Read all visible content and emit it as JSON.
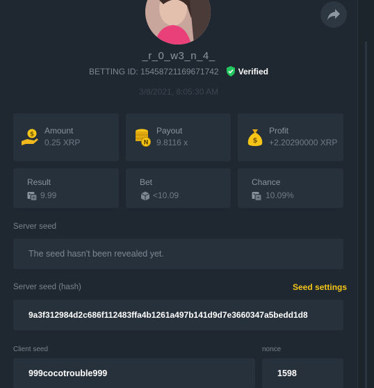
{
  "profile": {
    "username": "_r_0_w3_n_4_",
    "betting_id": "BETTING ID: 15458721169671742",
    "verified_label": "Verified",
    "date": "3/8/2021, 8:05:30 AM"
  },
  "stats": {
    "amount": {
      "label": "Amount",
      "value": "0.25 XRP",
      "icon": "money-bag-icon"
    },
    "payout": {
      "label": "Payout",
      "value": "9.8116 x",
      "icon": "coin-stack-icon"
    },
    "profit": {
      "label": "Profit",
      "value": "+2.20290000 XRP",
      "icon": "money-sack-icon"
    },
    "result": {
      "label": "Result",
      "value": "9.99",
      "icon": "dice-icon"
    },
    "bet": {
      "label": "Bet",
      "value": "<10.09",
      "icon": "cube-icon"
    },
    "chance": {
      "label": "Chance",
      "value": "10.09%",
      "icon": "dice-icon"
    }
  },
  "server_seed": {
    "label": "Server seed",
    "value": "The seed hasn't been revealed yet."
  },
  "server_seed_hash": {
    "label": "Server seed (hash)",
    "value": "9a3f312984d2c686f112483ffa4b1261a497b141d9d7e3660347a5bedd1d8",
    "settings_link": "Seed settings"
  },
  "client_seed": {
    "label": "Client seed",
    "value": "999cocotrouble999"
  },
  "nonce": {
    "label": "nonce",
    "value": "1598"
  },
  "colors": {
    "accent": "#f5c518",
    "verified": "#22c55e",
    "background": "#1f2730",
    "card": "#27313b"
  }
}
